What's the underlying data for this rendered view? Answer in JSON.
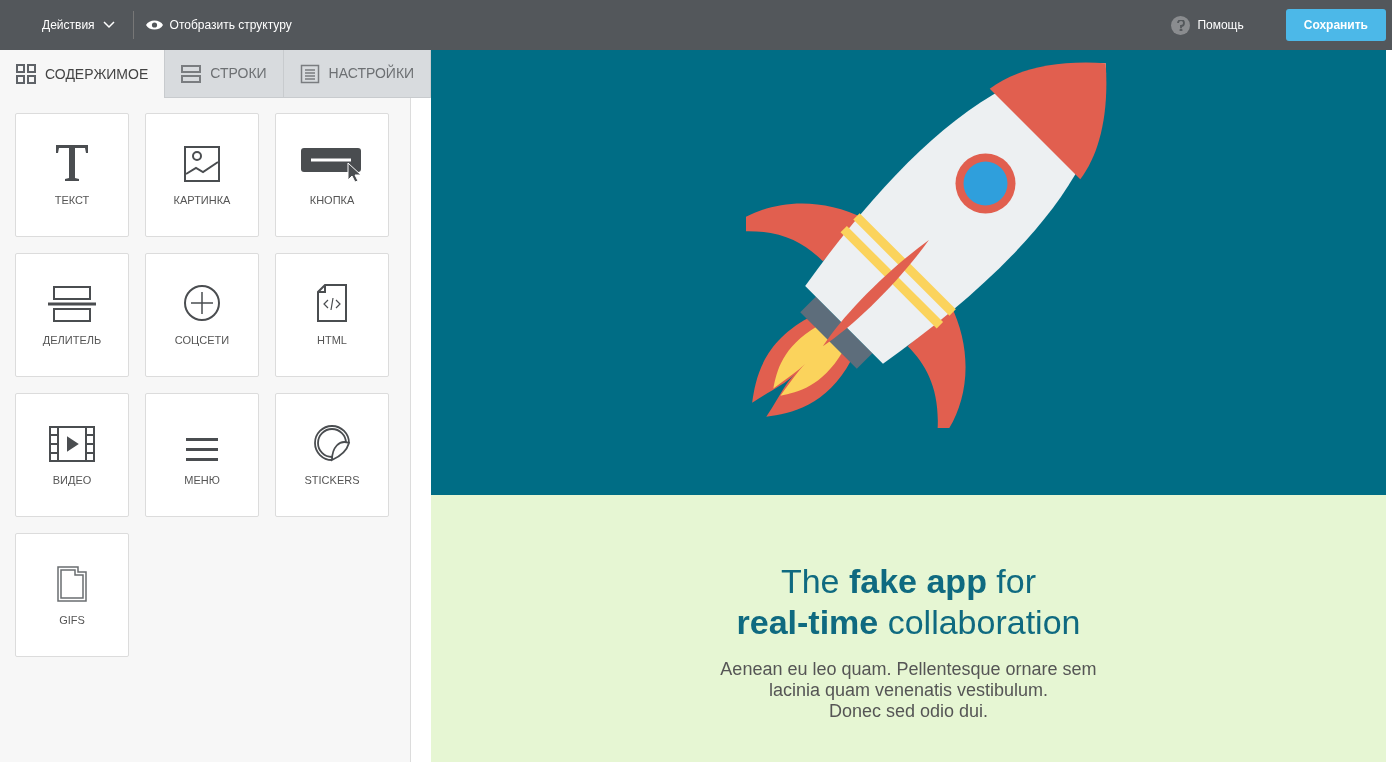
{
  "topbar": {
    "actions_menu": "Действия",
    "structure_toggle": "Отобразить структуру",
    "help": "Помощь",
    "save_button": "Сохранить"
  },
  "tabs": [
    {
      "label": "СОДЕРЖИМОЕ",
      "kind": "grid",
      "selected": true
    },
    {
      "label": "СТРОКИ",
      "kind": "rows",
      "selected": false
    },
    {
      "label": "НАСТРОЙКИ",
      "kind": "settings",
      "selected": false
    }
  ],
  "blocks": [
    {
      "label": "ТЕКСТ",
      "kind": "text"
    },
    {
      "label": "КАРТИНКА",
      "kind": "image"
    },
    {
      "label": "КНОПКА",
      "kind": "button"
    },
    {
      "label": "ДЕЛИТЕЛЬ",
      "kind": "divider"
    },
    {
      "label": "СОЦСЕТИ",
      "kind": "social"
    },
    {
      "label": "HTML",
      "kind": "html"
    },
    {
      "label": "ВИДЕО",
      "kind": "video"
    },
    {
      "label": "МЕНЮ",
      "kind": "menu"
    },
    {
      "label": "STICKERS",
      "kind": "stickers"
    },
    {
      "label": "GIFS",
      "kind": "gifs"
    }
  ],
  "canvas": {
    "headline": "The **fake app** for\n**real-time** collaboration",
    "body": "Aenean eu leo quam. Pellentesque ornare sem\nlacinia quam venenatis vestibulum.\nDonec sed odio dui."
  }
}
